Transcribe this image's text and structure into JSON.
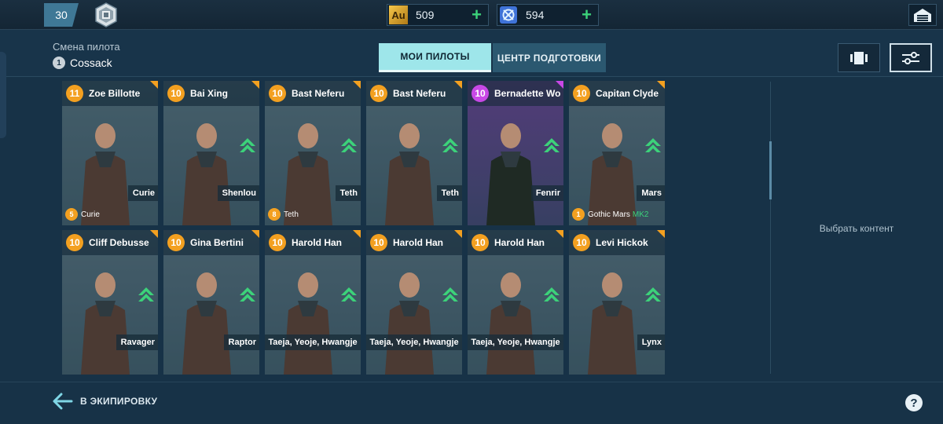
{
  "topbar": {
    "level": "30",
    "rank_icon": "rank-emblem-icon",
    "gold": {
      "label": "Au",
      "value": "509",
      "plus": "+"
    },
    "silver": {
      "value": "594",
      "plus": "+"
    },
    "garage_icon": "hangar-icon"
  },
  "header": {
    "change_pilot_label": "Смена пилота",
    "change_pilot_num": "1",
    "change_pilot_name": "Cossack",
    "tabs": [
      {
        "label": "МОИ ПИЛОТЫ",
        "active": true
      },
      {
        "label": "ЦЕНТР ПОДГОТОВКИ",
        "active": false
      }
    ]
  },
  "cards": [
    {
      "level": "11",
      "name": "Zoe Billotte",
      "robot": "Curie",
      "upgrade": false,
      "tag_num": "5",
      "tag_text": "Curie",
      "rarity": "orange",
      "bg": "#3a5563"
    },
    {
      "level": "10",
      "name": "Bai Xing",
      "robot": "Shenlou",
      "upgrade": true,
      "rarity": "orange",
      "bg": "#3c5664"
    },
    {
      "level": "10",
      "name": "Bast Neferu",
      "robot": "Teth",
      "upgrade": true,
      "tag_num": "8",
      "tag_text": "Teth",
      "rarity": "orange",
      "bg": "#3d5765"
    },
    {
      "level": "10",
      "name": "Bast Neferu",
      "robot": "Teth",
      "upgrade": true,
      "rarity": "orange",
      "bg": "#3d5765"
    },
    {
      "level": "10",
      "name": "Bernadette Wo",
      "robot": "Fenrir",
      "upgrade": true,
      "rarity": "purple",
      "bg": "#4f3c73"
    },
    {
      "level": "10",
      "name": "Capitan Clyde",
      "robot": "Mars",
      "upgrade": true,
      "tag_num": "1",
      "tag_text": "Gothic Mars",
      "tag_extra": "MK2",
      "rarity": "orange",
      "bg": "#3e5565"
    },
    {
      "level": "10",
      "name": "Cliff Debusse",
      "robot": "Ravager",
      "upgrade": true,
      "rarity": "orange",
      "bg": "#3b5463"
    },
    {
      "level": "10",
      "name": "Gina Bertini",
      "robot": "Raptor",
      "upgrade": true,
      "rarity": "orange",
      "bg": "#3c5564"
    },
    {
      "level": "10",
      "name": "Harold Han",
      "robot": "Taeja, Yeoje, Hwangje",
      "upgrade": true,
      "rarity": "orange",
      "bg": "#3b5463"
    },
    {
      "level": "10",
      "name": "Harold Han",
      "robot": "Taeja, Yeoje, Hwangje",
      "upgrade": true,
      "rarity": "orange",
      "bg": "#3b5463"
    },
    {
      "level": "10",
      "name": "Harold Han",
      "robot": "Taeja, Yeoje, Hwangje",
      "upgrade": true,
      "rarity": "orange",
      "bg": "#3b5463"
    },
    {
      "level": "10",
      "name": "Levi Hickok",
      "robot": "Lynx",
      "upgrade": true,
      "rarity": "orange",
      "bg": "#3c5564"
    }
  ],
  "side_panel": {
    "text": "Выбрать контент"
  },
  "footer": {
    "back_label": "В ЭКИПИРОВКУ",
    "help": "?"
  },
  "colors": {
    "accent_tab": "#9ee6ea",
    "level_orange": "#f3a020",
    "level_purple": "#c848e6",
    "upgrade_green": "#3cd27a"
  }
}
